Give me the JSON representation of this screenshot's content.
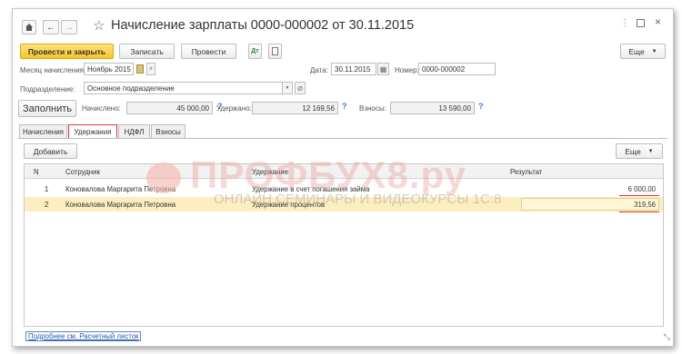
{
  "window": {
    "title": "Начисление зарплаты 0000-000002 от 30.11.2015",
    "star_icon": "star-icon"
  },
  "toolbar": {
    "post_close_label": "Провести и закрыть",
    "save_label": "Записать",
    "post_label": "Провести",
    "more_label": "Еще"
  },
  "form": {
    "month_label": "Месяц начисления:",
    "month_value": "Ноябрь 2015",
    "date_label": "Дата:",
    "date_value": "30.11.2015",
    "number_label": "Номер:",
    "number_value": "0000-000002",
    "department_label": "Подразделение:",
    "department_value": "Основное подразделение"
  },
  "totals": {
    "fill_label": "Заполнить",
    "accrued_label": "Начислено:",
    "accrued_value": "45 000,00",
    "withheld_label": "Удержано:",
    "withheld_value": "12 169,56",
    "contrib_label": "Взносы:",
    "contrib_value": "13 590,00"
  },
  "tabs": [
    "Начисления",
    "Удержания",
    "НДФЛ",
    "Взносы"
  ],
  "tab_toolbar": {
    "add_label": "Добавить",
    "more_label": "Еще"
  },
  "table": {
    "columns": [
      "N",
      "Сотрудник",
      "Удержание",
      "Результат"
    ],
    "rows": [
      {
        "n": "1",
        "employee": "Коновалова Маргарита Петровна",
        "deduction": "Удержание в счет погашения займа",
        "result": "6 000,00"
      },
      {
        "n": "2",
        "employee": "Коновалова Маргарита Петровна",
        "deduction": "Удержание процентов",
        "result": "319,56"
      }
    ]
  },
  "watermark": {
    "brand": "ПРОФБУХ8.ру",
    "tagline": "ОНЛАЙН СЕМИНАРЫ И ВИДЕОКУРСЫ 1С:8"
  },
  "footer": {
    "payslip_link": "Подробнее см. Расчетный листок"
  },
  "colors": {
    "primary_button": "#f7c52c",
    "highlight_red": "#e03434",
    "selected_row": "#fbeec0",
    "help_blue": "#3b78d0"
  }
}
